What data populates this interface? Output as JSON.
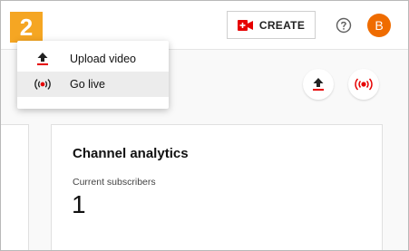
{
  "step": {
    "number": "2",
    "color": "#f5a623"
  },
  "header": {
    "create_label": "CREATE",
    "avatar_letter": "B",
    "avatar_color": "#ef6c00",
    "icons": [
      "video-plus-icon",
      "help-icon"
    ]
  },
  "menu": {
    "items": [
      {
        "label": "Upload video",
        "icon": "upload-icon",
        "highlighted": false
      },
      {
        "label": "Go live",
        "icon": "live-broadcast-icon",
        "highlighted": true
      }
    ]
  },
  "quick_actions": {
    "icons": [
      "upload-icon",
      "live-broadcast-icon"
    ]
  },
  "analytics": {
    "title": "Channel analytics",
    "subscribers_label": "Current subscribers",
    "subscribers_value": "1"
  },
  "colors": {
    "accent_red": "#e60000"
  }
}
